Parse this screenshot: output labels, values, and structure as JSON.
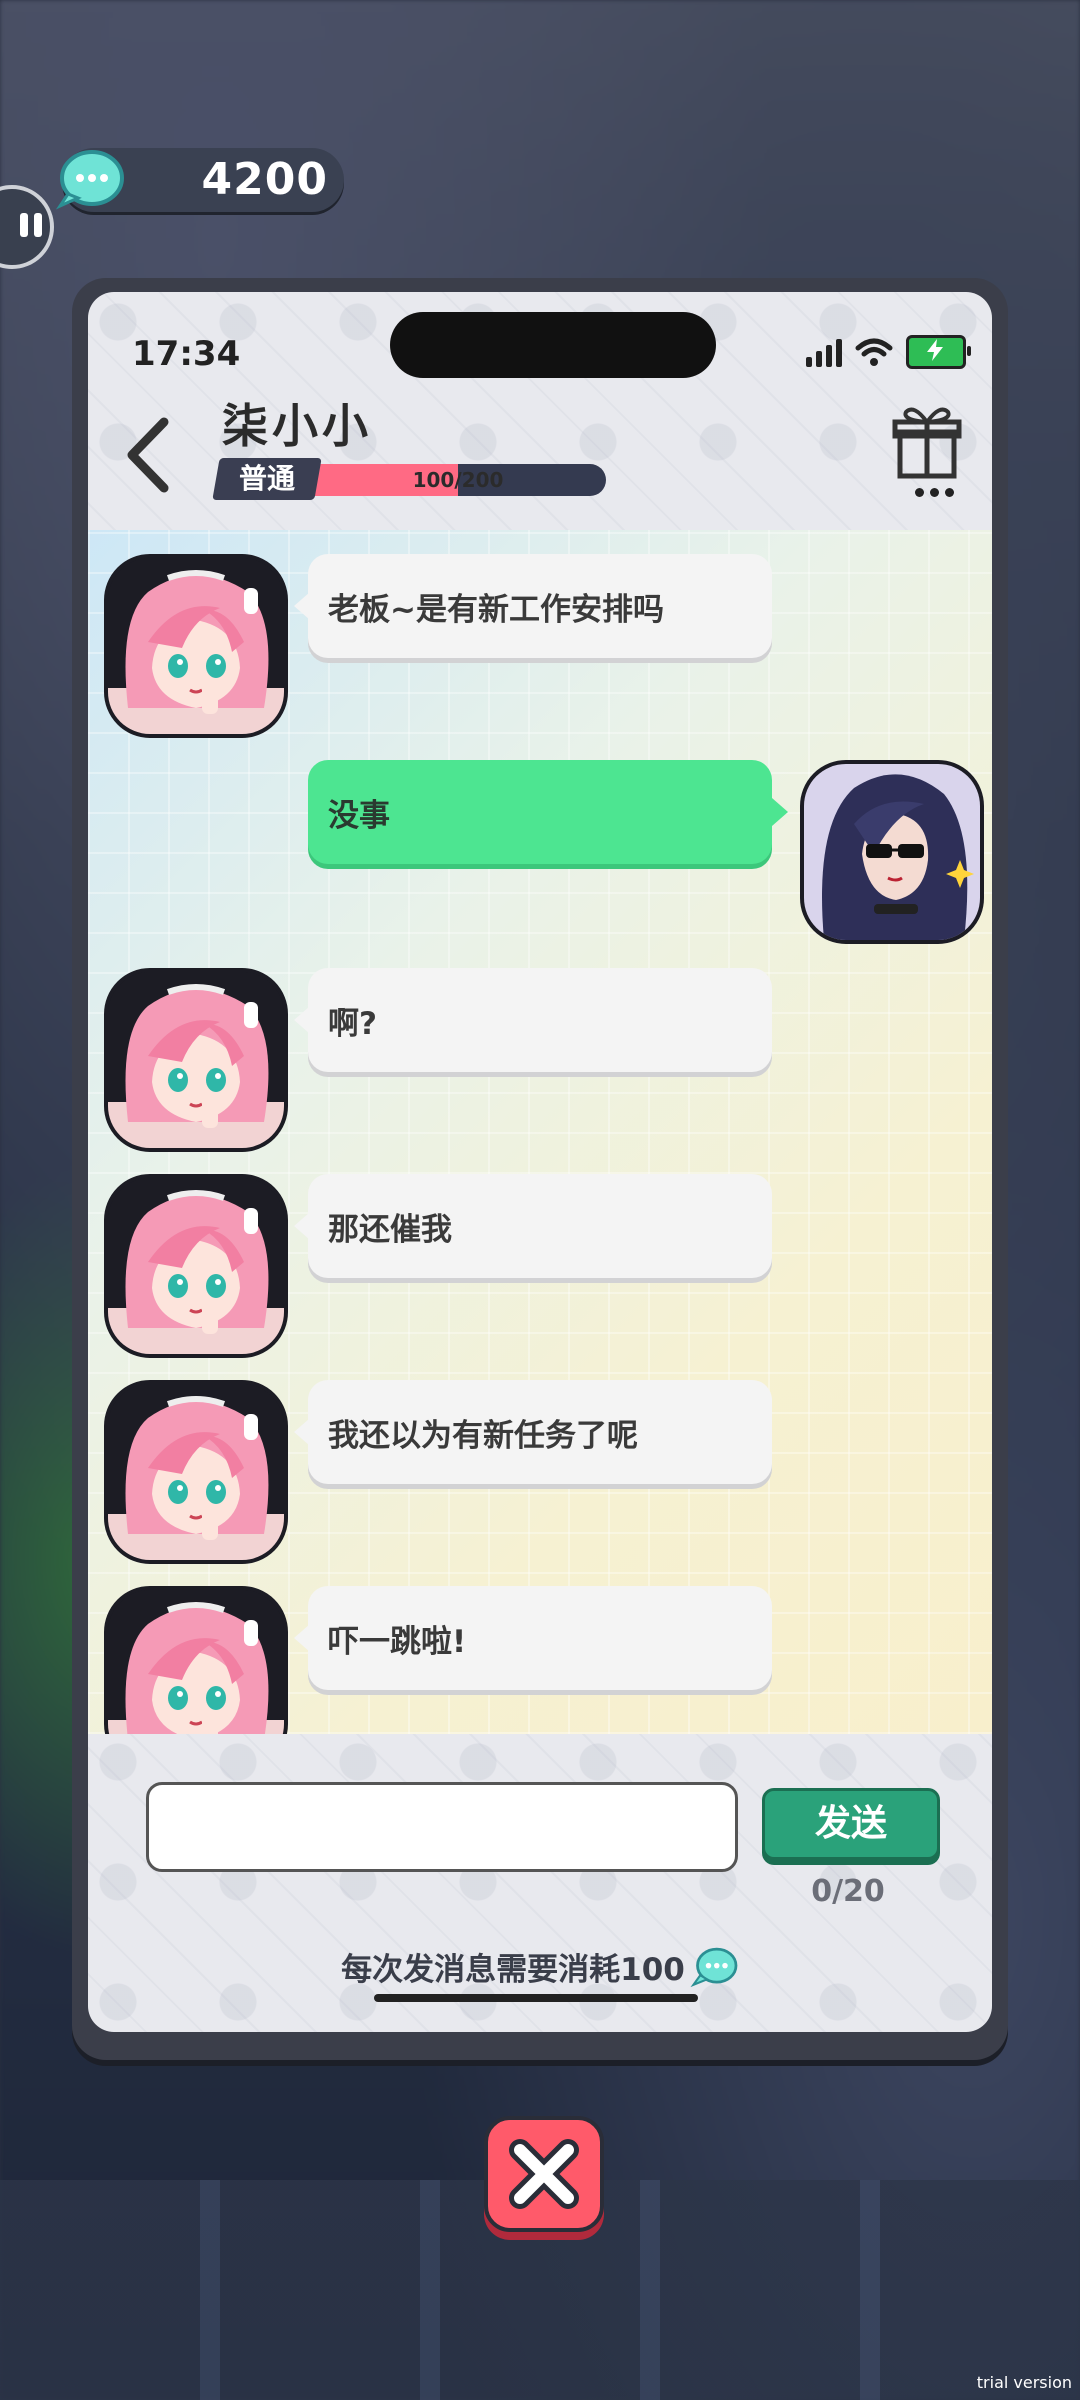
{
  "hud": {
    "currency_amount": "4200",
    "currency_icon": "chat-bubble-coin-icon"
  },
  "phone": {
    "status": {
      "time": "17:34"
    },
    "header": {
      "contact_name": "柒小小",
      "relationship_level": "普通",
      "affinity_text": "100/200",
      "affinity_value": 100,
      "affinity_max": 200
    },
    "messages": [
      {
        "side": "left",
        "text": "老板~是有新工作安排吗"
      },
      {
        "side": "right",
        "text": "没事"
      },
      {
        "side": "left",
        "text": "啊?"
      },
      {
        "side": "left",
        "text": "那还催我"
      },
      {
        "side": "left",
        "text": "我还以为有新任务了呢"
      },
      {
        "side": "left",
        "text": "吓一跳啦!"
      }
    ],
    "input": {
      "value": "",
      "placeholder": ""
    },
    "send_label": "发送",
    "char_count": "0/20",
    "cost_notice": "每次发消息需要消耗100"
  },
  "footer": {
    "watermark": "trial version"
  },
  "colors": {
    "accent_green": "#4de591",
    "send_green": "#2aa27a",
    "affinity_pink": "#ff6a84",
    "close_red": "#ff5a6a"
  }
}
